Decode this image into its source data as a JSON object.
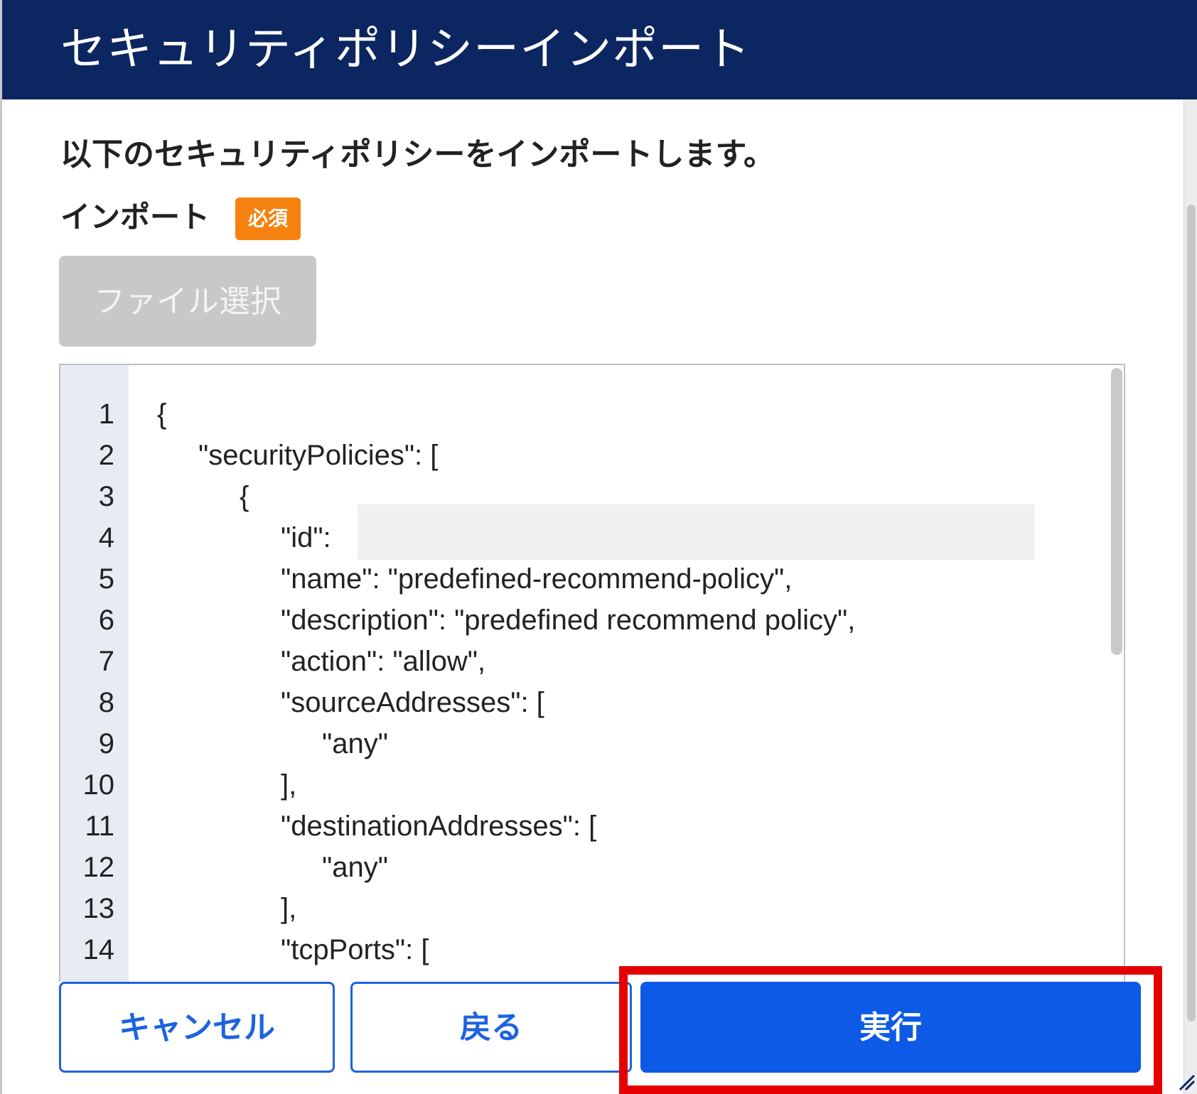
{
  "dialog": {
    "title": "セキュリティポリシーインポート",
    "intro": "以下のセキュリティポリシーをインポートします。",
    "field_label": "インポート",
    "required_badge": "必須",
    "file_button": "ファイル選択"
  },
  "editor": {
    "lines": [
      {
        "num": "1",
        "code": "{"
      },
      {
        "num": "2",
        "code": "\"securityPolicies\": ["
      },
      {
        "num": "3",
        "code": "{"
      },
      {
        "num": "4",
        "code": "\"id\":"
      },
      {
        "num": "5",
        "code": "\"name\": \"predefined-recommend-policy\","
      },
      {
        "num": "6",
        "code": "\"description\": \"predefined recommend policy\","
      },
      {
        "num": "7",
        "code": "\"action\": \"allow\","
      },
      {
        "num": "8",
        "code": "\"sourceAddresses\": ["
      },
      {
        "num": "9",
        "code": "\"any\""
      },
      {
        "num": "10",
        "code": "],"
      },
      {
        "num": "11",
        "code": "\"destinationAddresses\": ["
      },
      {
        "num": "12",
        "code": "\"any\""
      },
      {
        "num": "13",
        "code": "],"
      },
      {
        "num": "14",
        "code": "\"tcpPorts\": ["
      }
    ]
  },
  "buttons": {
    "cancel": "キャンセル",
    "back": "戻る",
    "execute": "実行"
  },
  "colors": {
    "header_bg": "#0b2660",
    "primary": "#0d5ae6",
    "badge": "#f5820f",
    "highlight": "#e50000"
  }
}
